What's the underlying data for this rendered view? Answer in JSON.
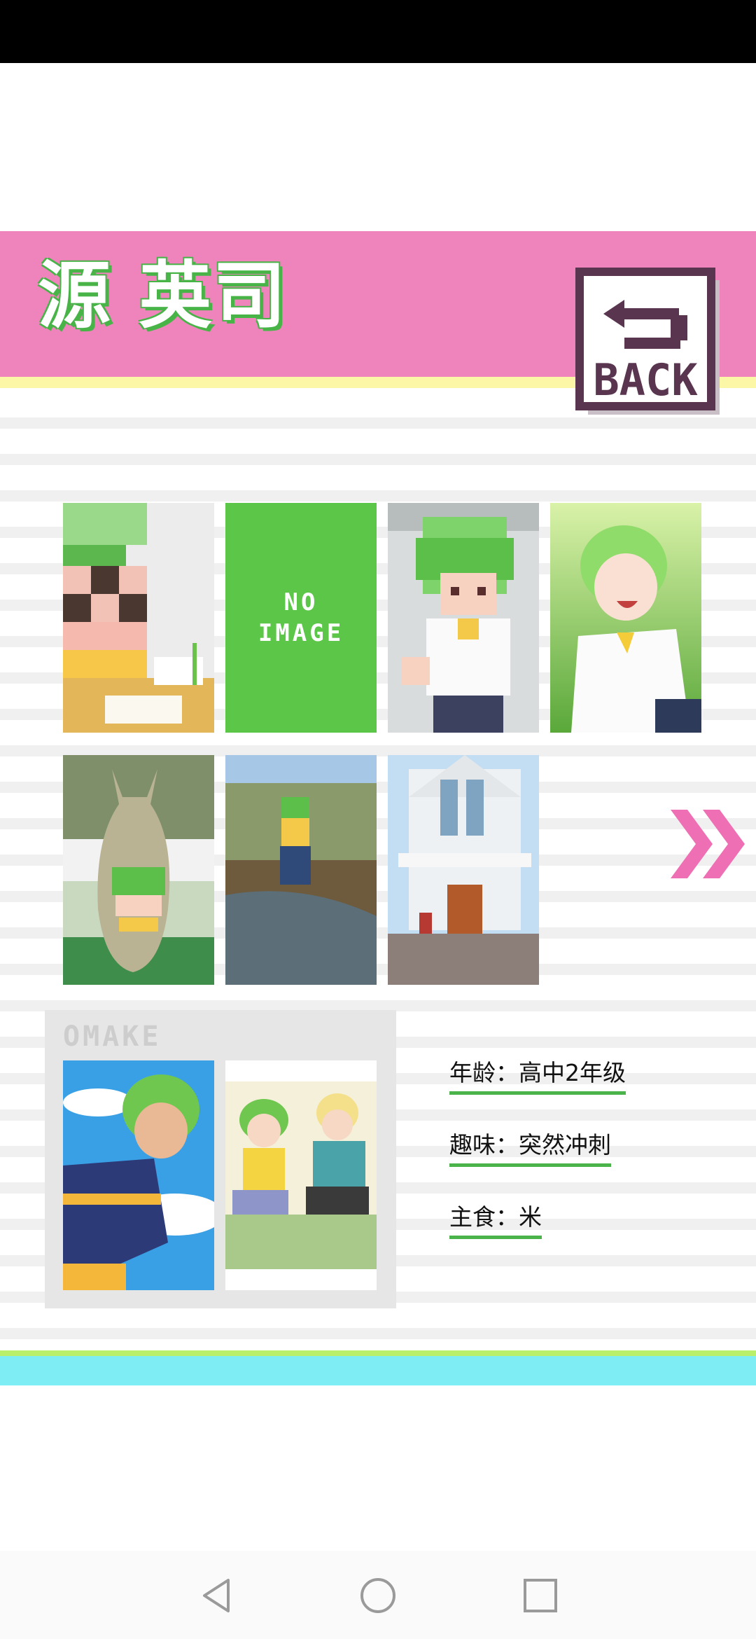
{
  "character": {
    "name": "源 英司"
  },
  "back_button": {
    "label": "BACK",
    "icon": "back-arrow-icon"
  },
  "gallery": {
    "row1": [
      {
        "id": "photo-1",
        "kind": "image",
        "desc": "pixel-art-desk"
      },
      {
        "id": "photo-2",
        "kind": "placeholder",
        "text": "NO\nIMAGE"
      },
      {
        "id": "photo-3",
        "kind": "image",
        "desc": "pixel-art-boy"
      },
      {
        "id": "photo-4",
        "kind": "image",
        "desc": "anime-boy-smiling"
      }
    ],
    "row2": [
      {
        "id": "photo-5",
        "kind": "image",
        "desc": "kangaroo-statue"
      },
      {
        "id": "photo-6",
        "kind": "image",
        "desc": "stream-forest"
      },
      {
        "id": "photo-7",
        "kind": "image",
        "desc": "white-church"
      }
    ],
    "next_icon": "double-chevron-right-icon"
  },
  "omake": {
    "label": "OMAKE",
    "items": [
      {
        "id": "omake-1",
        "desc": "boy-sky"
      },
      {
        "id": "omake-2",
        "desc": "two-boys-gaming"
      }
    ]
  },
  "profile": {
    "age": "年龄：高中2年级",
    "hobby": "趣味：突然冲刺",
    "staple": "主食：米"
  },
  "colors": {
    "header_pink": "#ef84bd",
    "accent_green": "#5cc648",
    "bottom_cyan": "#7feef4",
    "arrow_pink": "#ef6fb4"
  },
  "nav": {
    "back_icon": "triangle-back-icon",
    "home_icon": "circle-home-icon",
    "recents_icon": "square-recents-icon"
  }
}
